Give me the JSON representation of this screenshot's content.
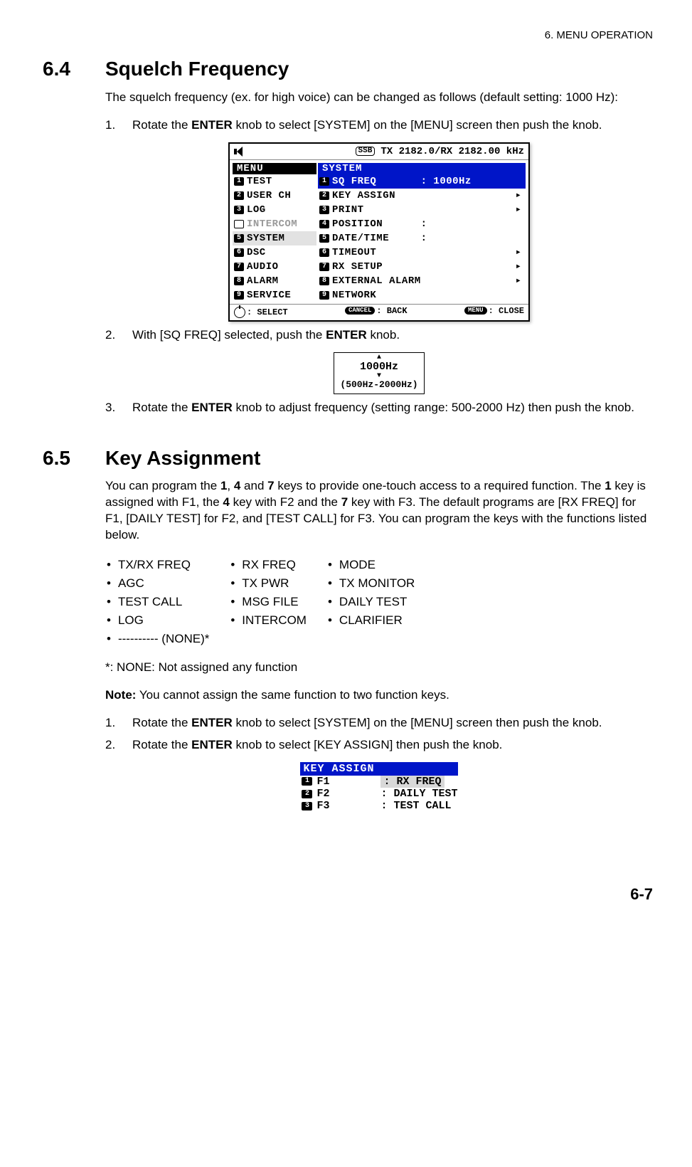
{
  "header": {
    "chapter": "6.  MENU OPERATION"
  },
  "section64": {
    "num": "6.4",
    "title": "Squelch Frequency",
    "intro": "The squelch frequency (ex. for high voice) can be changed as follows (default setting: 1000 Hz):",
    "step1_pre": "Rotate the ",
    "step1_b": "ENTER",
    "step1_post": " knob to select [SYSTEM] on the [MENU] screen then push the knob.",
    "step2_pre": "With [SQ FREQ] selected, push the ",
    "step2_b": "ENTER",
    "step2_post": " knob.",
    "step3_pre": "Rotate the ",
    "step3_b": "ENTER",
    "step3_post": " knob to adjust frequency (setting range: 500-2000 Hz) then push the knob."
  },
  "lcd": {
    "ssb": "SSB",
    "freq": "TX 2182.0/RX 2182.00 kHz",
    "menu_hdr": "MENU",
    "system_hdr": "SYSTEM",
    "left": [
      "TEST",
      "USER CH",
      "LOG",
      "INTERCOM",
      "SYSTEM",
      "DSC",
      "AUDIO",
      "ALARM",
      "SERVICE"
    ],
    "right": [
      {
        "t": "SQ FREQ",
        "v": ": 1000Hz",
        "sel": true
      },
      {
        "t": "KEY ASSIGN",
        "a": true
      },
      {
        "t": "PRINT",
        "a": true
      },
      {
        "t": "POSITION",
        "v": ":"
      },
      {
        "t": "DATE/TIME",
        "v": ":"
      },
      {
        "t": "TIMEOUT",
        "a": true
      },
      {
        "t": "RX SETUP",
        "a": true
      },
      {
        "t": "EXTERNAL ALARM",
        "a": true
      },
      {
        "t": "NETWORK"
      }
    ],
    "foot_select": ": SELECT",
    "foot_back": ": BACK",
    "foot_close": ": CLOSE",
    "pill_cancel": "CANCEL",
    "pill_menu": "MENU"
  },
  "freqbox": {
    "val": "1000Hz",
    "range": "(500Hz-2000Hz)"
  },
  "section65": {
    "num": "6.5",
    "title": "Key Assignment",
    "intro_parts": [
      "You can program the ",
      "1",
      ", ",
      "4",
      " and ",
      "7",
      " keys to provide one-touch access to a required function. The ",
      "1",
      " key is assigned with F1, the ",
      "4",
      " key with F2 and the ",
      "7",
      " key with F3. The default programs are [RX FREQ] for F1, [DAILY TEST] for F2, and [TEST CALL] for F3. You can program the keys with the functions listed below."
    ],
    "col1": [
      "TX/RX FREQ",
      "AGC",
      "TEST CALL",
      "LOG",
      "---------- (NONE)*"
    ],
    "col2": [
      "RX FREQ",
      "TX PWR",
      "MSG FILE",
      "INTERCOM"
    ],
    "col3": [
      "MODE",
      "TX MONITOR",
      "DAILY TEST",
      "CLARIFIER"
    ],
    "note_star": "*: NONE: Not assigned any function",
    "note_b": "Note:",
    "note_rest": " You cannot assign the same function to two function keys.",
    "step1_pre": "Rotate the ",
    "step1_b": "ENTER",
    "step1_post": " knob to select [SYSTEM] on the [MENU] screen then push the knob.",
    "step2_pre": "Rotate the ",
    "step2_b": "ENTER",
    "step2_post": " knob to select [KEY ASSIGN] then push the knob."
  },
  "kabox": {
    "hdr": "KEY ASSIGN",
    "rows": [
      {
        "n": "1",
        "k": "F1",
        "v": ": RX FREQ",
        "sel": true
      },
      {
        "n": "2",
        "k": "F2",
        "v": ": DAILY TEST"
      },
      {
        "n": "3",
        "k": "F3",
        "v": ": TEST CALL"
      }
    ]
  },
  "page": "6-7"
}
